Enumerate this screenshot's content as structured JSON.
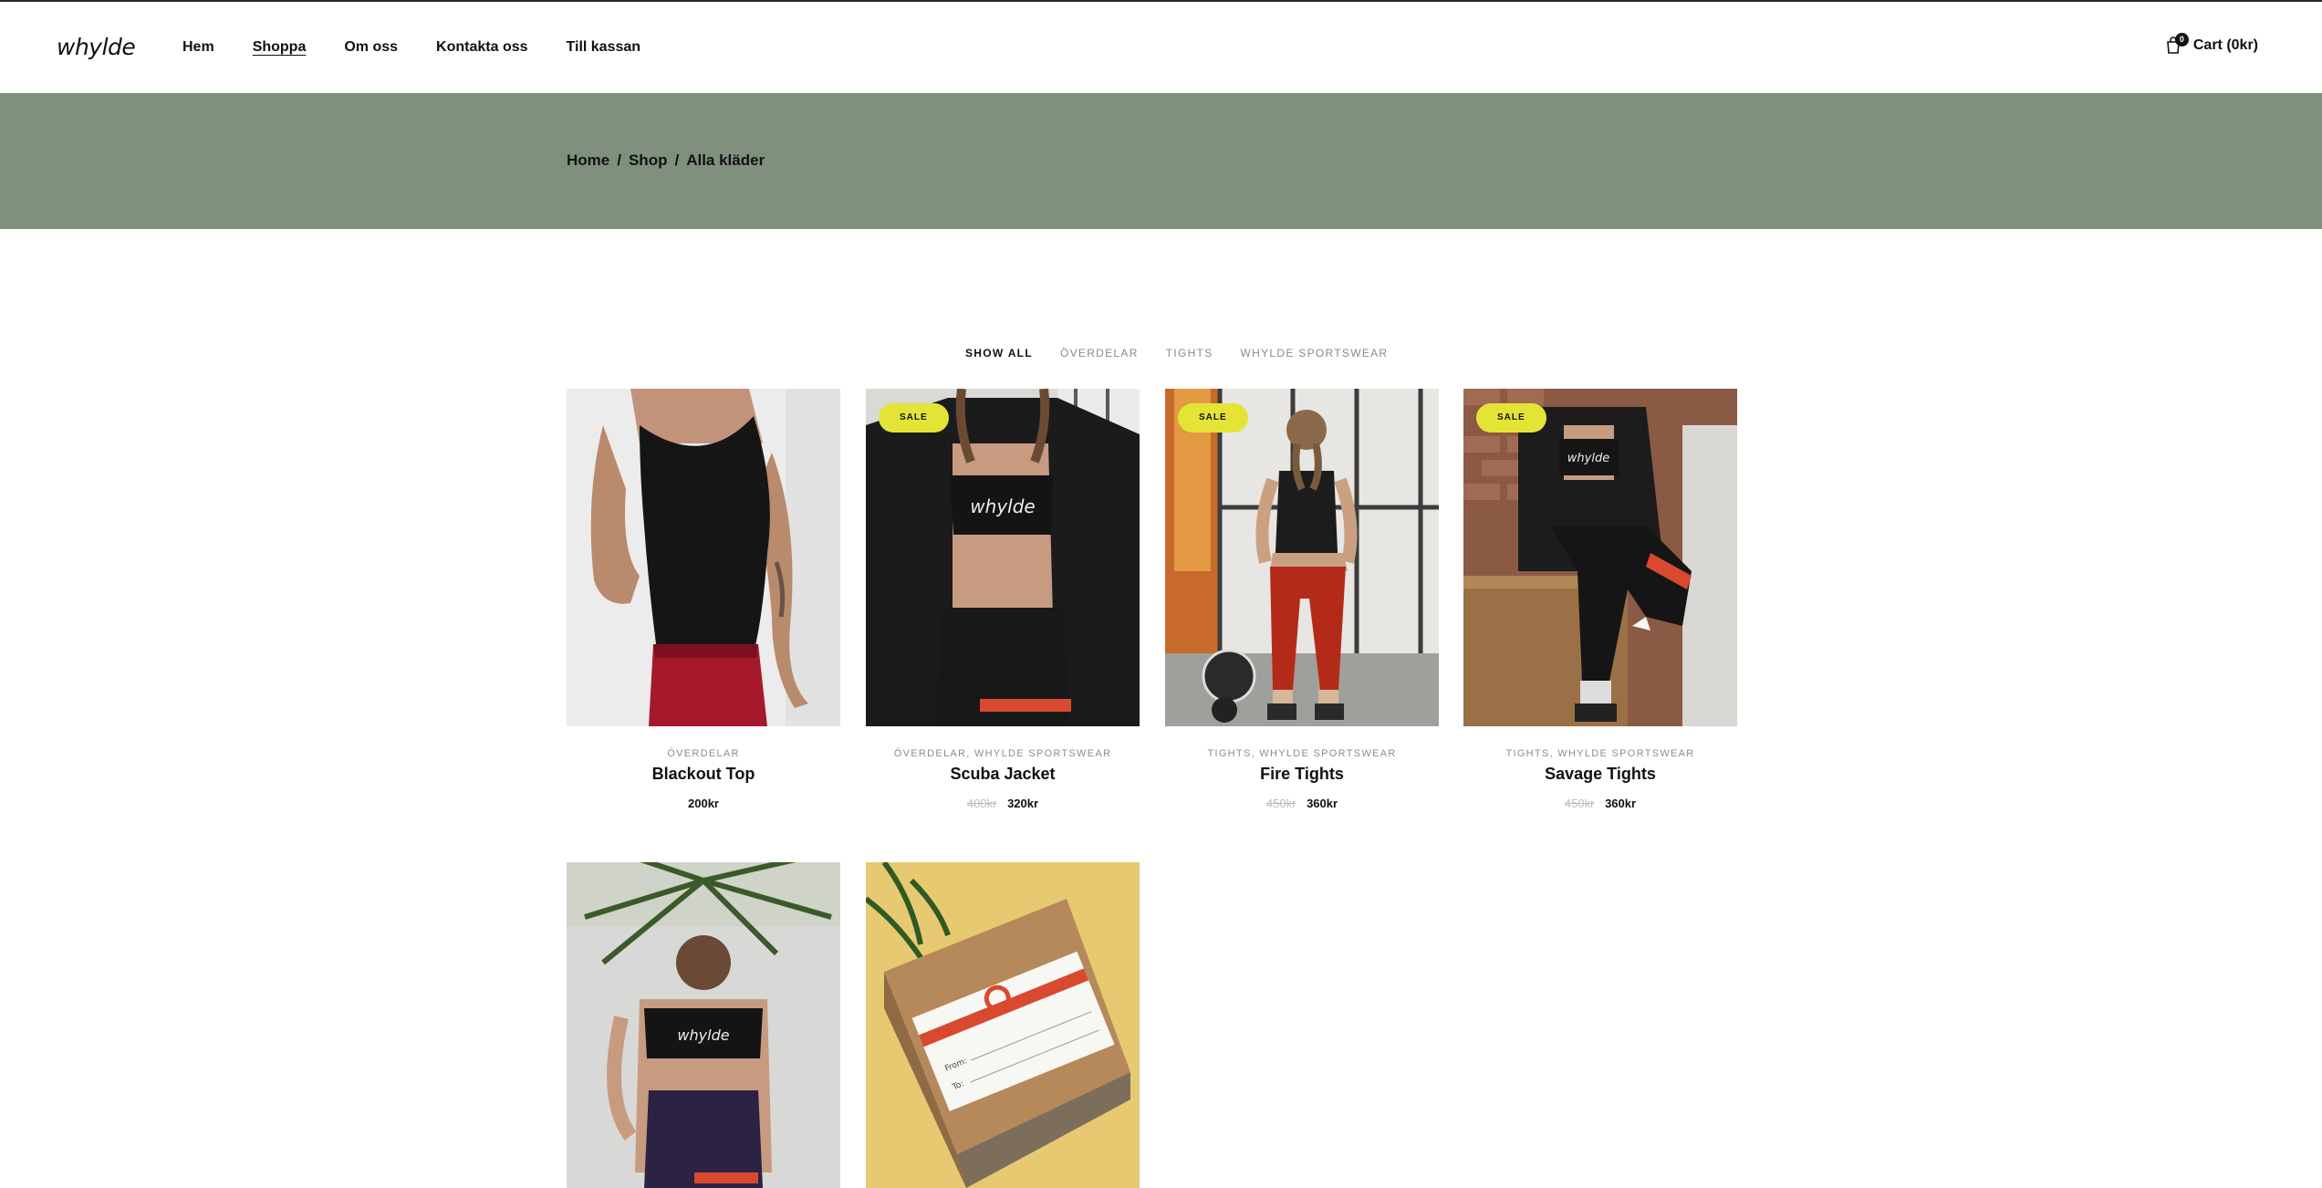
{
  "brand": {
    "logo_text": "whylde"
  },
  "nav": {
    "items": [
      {
        "label": "Hem"
      },
      {
        "label": "Shoppa"
      },
      {
        "label": "Om oss"
      },
      {
        "label": "Kontakta oss"
      },
      {
        "label": "Till kassan"
      }
    ]
  },
  "cart": {
    "count": "0",
    "label": "Cart (0kr)"
  },
  "breadcrumb": {
    "home": "Home",
    "sep1": "/",
    "shop": "Shop",
    "sep2": "/",
    "current": "Alla kläder"
  },
  "filters": [
    {
      "label": "SHOW ALL"
    },
    {
      "label": "ÖVERDELAR"
    },
    {
      "label": "TIGHTS"
    },
    {
      "label": "WHYLDE SPORTSWEAR"
    }
  ],
  "products": [
    {
      "category": "ÖVERDELAR",
      "name": "Blackout Top",
      "price": "200kr",
      "old_price": "",
      "badge": ""
    },
    {
      "category": "ÖVERDELAR, WHYLDE SPORTSWEAR",
      "name": "Scuba Jacket",
      "price": "320kr",
      "old_price": "400kr",
      "badge": "SALE"
    },
    {
      "category": "TIGHTS, WHYLDE SPORTSWEAR",
      "name": "Fire Tights",
      "price": "360kr",
      "old_price": "450kr",
      "badge": "SALE"
    },
    {
      "category": "TIGHTS, WHYLDE SPORTSWEAR",
      "name": "Savage Tights",
      "price": "360kr",
      "old_price": "450kr",
      "badge": "SALE"
    },
    {
      "category": "",
      "name": "",
      "price": "",
      "old_price": "",
      "badge": ""
    },
    {
      "category": "",
      "name": "",
      "price": "",
      "old_price": "",
      "badge": ""
    }
  ],
  "gift_card": {
    "from_label": "From:",
    "to_label": "To:"
  },
  "colors": {
    "hero_band": "#7f907d",
    "sale_badge": "#e4e436",
    "text": "#111111",
    "muted": "#8a8a8a"
  }
}
